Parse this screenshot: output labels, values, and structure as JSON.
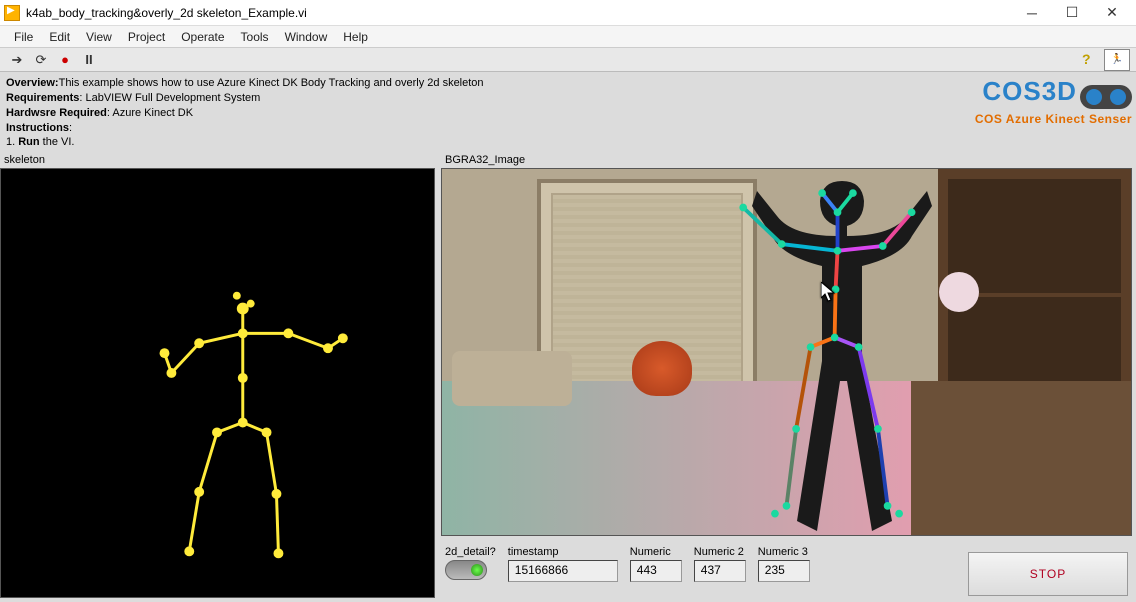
{
  "window": {
    "title": "k4ab_body_tracking&overly_2d skeleton_Example.vi"
  },
  "menu": [
    "File",
    "Edit",
    "View",
    "Project",
    "Operate",
    "Tools",
    "Window",
    "Help"
  ],
  "info": {
    "overview_label": "Overview:",
    "overview_text": "This example shows how to use   Azure Kinect DK Body Tracking and overly 2d skeleton",
    "requirements_label": "Requirements",
    "requirements_text": ": LabVIEW Full Development System",
    "hardware_label": "Hardwsre Required",
    "hardware_text": ": Azure Kinect DK",
    "instructions_label": "Instructions",
    "instructions_text": ":",
    "step1_a": "1. ",
    "step1_b": "Run",
    "step1_c": " the VI."
  },
  "logo": {
    "main": "COS3D",
    "sub": "COS Azure Kinect Senser"
  },
  "labels": {
    "skeleton": "skeleton",
    "image": "BGRA32_Image"
  },
  "controls": {
    "detail_label": "2d_detail?",
    "timestamp_label": "timestamp",
    "timestamp_value": "15166866",
    "numeric_label": "Numeric",
    "numeric_value": "443",
    "numeric2_label": "Numeric 2",
    "numeric2_value": "437",
    "numeric3_label": "Numeric 3",
    "numeric3_value": "235",
    "stop_label": "STOP"
  }
}
